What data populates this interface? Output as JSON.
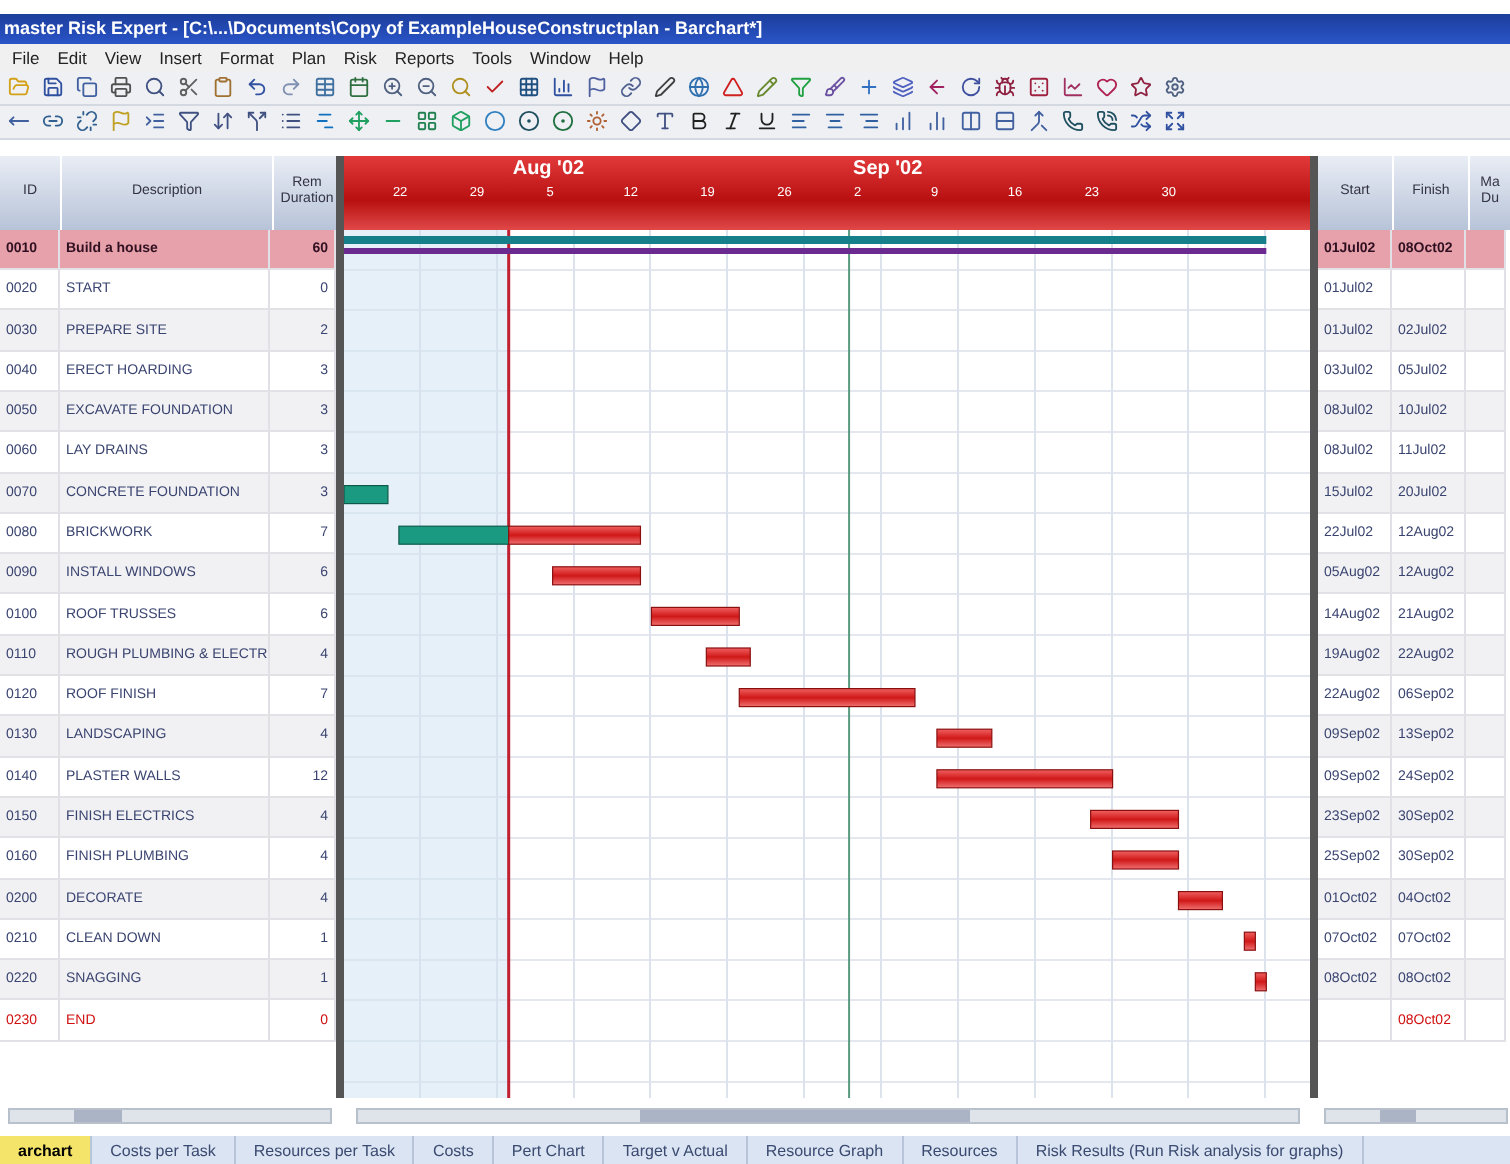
{
  "window": {
    "title": "master Risk Expert - [C:\\...\\Documents\\Copy of ExampleHouseConstructplan - Barchart*]"
  },
  "menu": [
    "File",
    "Edit",
    "View",
    "Insert",
    "Format",
    "Plan",
    "Risk",
    "Reports",
    "Tools",
    "Window",
    "Help"
  ],
  "table": {
    "columns": [
      "ID",
      "Description",
      "Rem Duration"
    ],
    "right_columns": [
      "Start",
      "Finish",
      "Ma Du"
    ]
  },
  "timeline": {
    "months": [
      "Aug '02",
      "Sep '02"
    ],
    "weeks": [
      "22",
      "29",
      "5",
      "12",
      "19",
      "26",
      "2",
      "9",
      "16",
      "23",
      "30"
    ]
  },
  "tasks": [
    {
      "id": "0010",
      "description": "Build a house",
      "duration": "60",
      "start": "01Jul02",
      "finish": "08Oct02",
      "kind": "summary"
    },
    {
      "id": "0020",
      "description": "START",
      "duration": "0",
      "start": "01Jul02",
      "kind": "task"
    },
    {
      "id": "0030",
      "description": "PREPARE SITE",
      "duration": "2",
      "start": "01Jul02",
      "finish": "02Jul02",
      "kind": "task"
    },
    {
      "id": "0040",
      "description": "ERECT HOARDING",
      "duration": "3",
      "start": "03Jul02",
      "finish": "05Jul02",
      "kind": "task"
    },
    {
      "id": "0050",
      "description": "EXCAVATE FOUNDATION",
      "duration": "3",
      "start": "08Jul02",
      "finish": "10Jul02",
      "kind": "task"
    },
    {
      "id": "0060",
      "description": "LAY DRAINS",
      "duration": "3",
      "start": "08Jul02",
      "finish": "11Jul02",
      "kind": "task"
    },
    {
      "id": "0070",
      "description": "CONCRETE FOUNDATION",
      "duration": "3",
      "start": "15Jul02",
      "finish": "20Jul02",
      "kind": "task"
    },
    {
      "id": "0080",
      "description": "BRICKWORK",
      "duration": "7",
      "start": "22Jul02",
      "finish": "12Aug02",
      "kind": "task"
    },
    {
      "id": "0090",
      "description": "INSTALL WINDOWS",
      "duration": "6",
      "start": "05Aug02",
      "finish": "12Aug02",
      "kind": "task"
    },
    {
      "id": "0100",
      "description": "ROOF TRUSSES",
      "duration": "6",
      "start": "14Aug02",
      "finish": "21Aug02",
      "kind": "task"
    },
    {
      "id": "0110",
      "description": "ROUGH PLUMBING & ELECTR",
      "duration": "4",
      "start": "19Aug02",
      "finish": "22Aug02",
      "kind": "task"
    },
    {
      "id": "0120",
      "description": "ROOF FINISH",
      "duration": "7",
      "start": "22Aug02",
      "finish": "06Sep02",
      "kind": "task"
    },
    {
      "id": "0130",
      "description": "LANDSCAPING",
      "duration": "4",
      "start": "09Sep02",
      "finish": "13Sep02",
      "kind": "task"
    },
    {
      "id": "0140",
      "description": "PLASTER WALLS",
      "duration": "12",
      "start": "09Sep02",
      "finish": "24Sep02",
      "kind": "task"
    },
    {
      "id": "0150",
      "description": "FINISH ELECTRICS",
      "duration": "4",
      "start": "23Sep02",
      "finish": "30Sep02",
      "kind": "task"
    },
    {
      "id": "0160",
      "description": "FINISH PLUMBING",
      "duration": "4",
      "start": "25Sep02",
      "finish": "30Sep02",
      "kind": "task"
    },
    {
      "id": "0200",
      "description": "DECORATE",
      "duration": "4",
      "start": "01Oct02",
      "finish": "04Oct02",
      "kind": "task"
    },
    {
      "id": "0210",
      "description": "CLEAN DOWN",
      "duration": "1",
      "start": "07Oct02",
      "finish": "07Oct02",
      "kind": "task"
    },
    {
      "id": "0220",
      "description": "SNAGGING",
      "duration": "1",
      "start": "08Oct02",
      "finish": "08Oct02",
      "kind": "task"
    },
    {
      "id": "0230",
      "description": "END",
      "duration": "0",
      "finish": "08Oct02",
      "kind": "end"
    }
  ],
  "tabs": [
    {
      "label": "archart",
      "selected": true
    },
    {
      "label": "Costs per Task",
      "selected": false
    },
    {
      "label": "Resources per Task",
      "selected": false
    },
    {
      "label": "Costs",
      "selected": false
    },
    {
      "label": "Pert Chart",
      "selected": false
    },
    {
      "label": "Target v Actual",
      "selected": false
    },
    {
      "label": "Resource Graph",
      "selected": false
    },
    {
      "label": "Resources",
      "selected": false
    },
    {
      "label": "Risk Results (Run Risk analysis for graphs)",
      "selected": false
    }
  ]
}
